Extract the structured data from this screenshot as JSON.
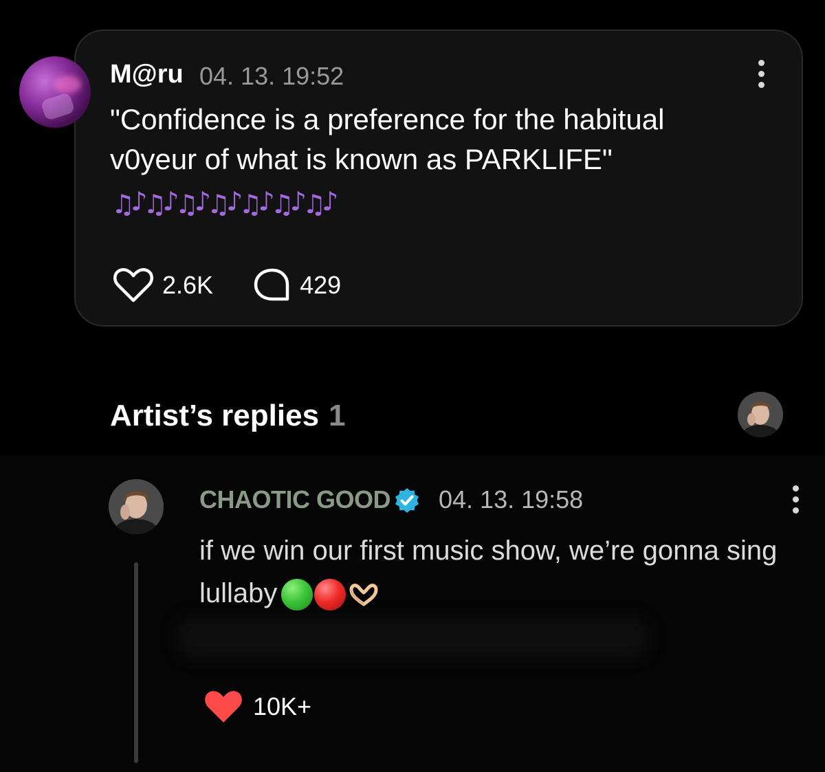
{
  "post": {
    "author": "M@ru",
    "timestamp": "04. 13. 19:52",
    "text_line1": "\"Confidence is a preference for the habitual",
    "text_line2": "v0yeur of what is known as PARKLIFE\"",
    "music_notes": [
      "♫",
      "♪",
      "♫",
      "♪",
      "♫",
      "♪",
      "♫",
      "♪",
      "♫",
      "♪",
      "♫",
      "♪",
      "♫",
      "♪"
    ],
    "likes": "2.6K",
    "comments": "429",
    "like_icon": "heart-outline-icon",
    "comment_icon": "speech-bubble-icon",
    "more_icon": "vertical-ellipsis-icon"
  },
  "replies_section": {
    "title": "Artist’s replies",
    "count": "1"
  },
  "reply": {
    "author": "CHAOTIC GOOD",
    "verified_icon": "verified-badge-icon",
    "timestamp": "04. 13. 19:58",
    "text": "if we win our first music show, we’re gonna sing lullaby",
    "emojis": [
      "green-circle-icon",
      "red-circle-icon",
      "heart-hands-icon"
    ],
    "likes": "10K+",
    "like_icon": "heart-filled-icon",
    "more_icon": "vertical-ellipsis-icon"
  },
  "colors": {
    "background": "#000000",
    "card": "#121212",
    "note_purple": "#a46be0",
    "verified": "#2fb3e0",
    "liked_red": "#ff4a4a",
    "reply_author": "#8a9a86"
  }
}
